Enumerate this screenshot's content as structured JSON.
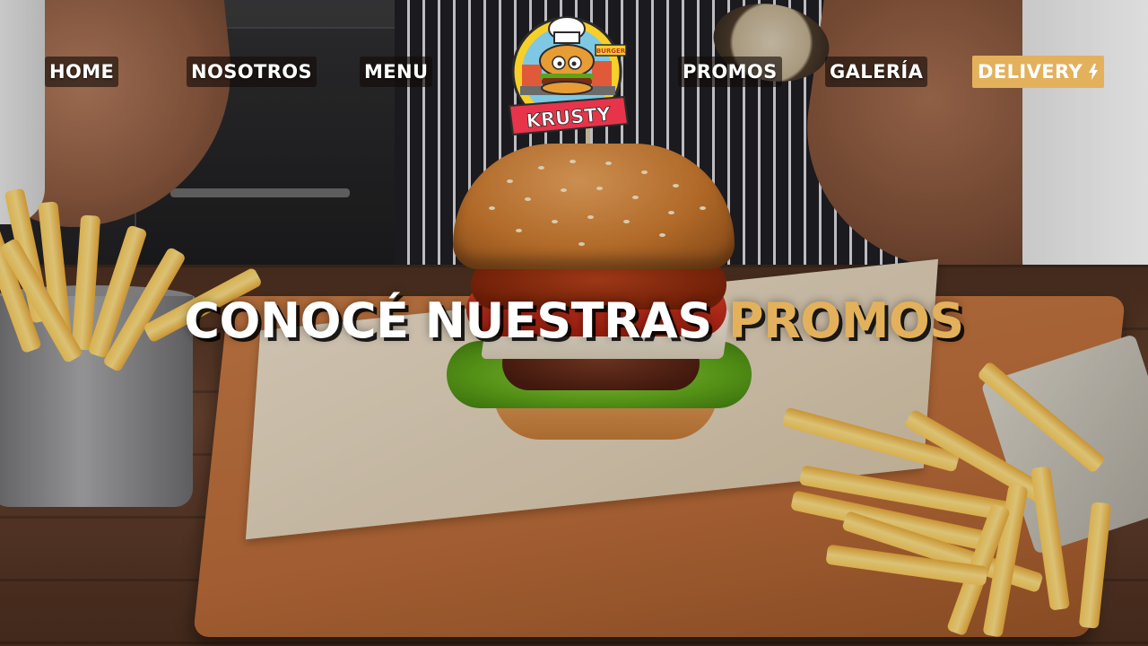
{
  "nav": {
    "home": "HOME",
    "about": "NOSOTROS",
    "menu": "MENU",
    "promos": "PROMOS",
    "gallery": "GALERÍA",
    "delivery": "DELIVERY",
    "delivery_icon": "lightning-bolt-icon"
  },
  "logo": {
    "text": "KRUSTY",
    "sign_text": "BURGER"
  },
  "hero": {
    "headline_part1": "CONOCÉ NUESTRAS ",
    "headline_part2": "PROMOS"
  },
  "colors": {
    "accent": "#e3b15c",
    "nav_text": "#ffffff",
    "logo_banner": "#e8344a"
  }
}
